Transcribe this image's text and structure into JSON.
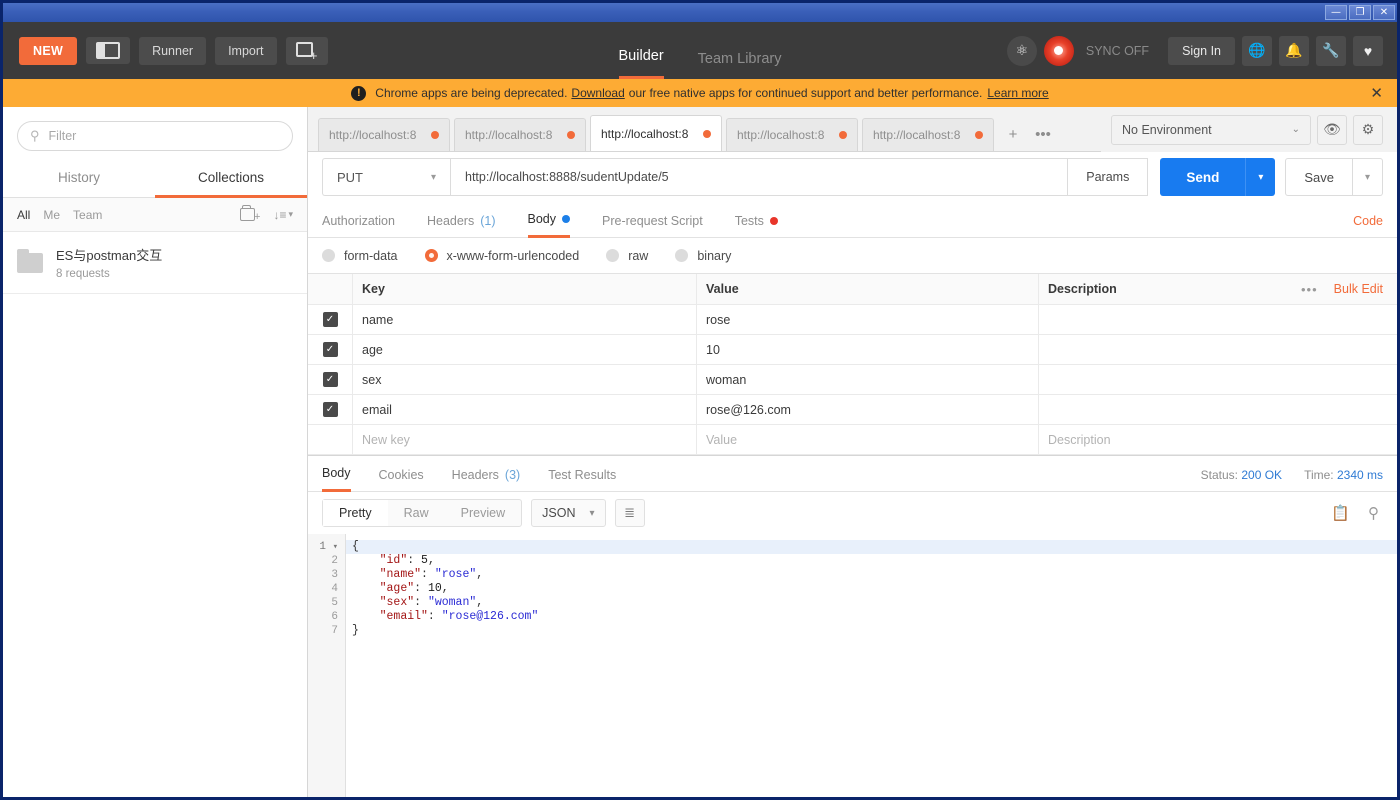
{
  "window": {
    "minimize_label": "—",
    "restore_label": "❐",
    "close_label": "✕"
  },
  "header": {
    "new_button": "NEW",
    "panel_toggle_name": "panel-toggle",
    "runner_button": "Runner",
    "import_button": "Import",
    "new_tab_button": "+",
    "tabs": [
      {
        "label": "Builder",
        "active": true
      },
      {
        "label": "Team Library",
        "active": false
      }
    ],
    "sync_label": "SYNC OFF",
    "signin_button": "Sign In",
    "icons": [
      "globe-icon",
      "bell-icon",
      "wrench-icon",
      "heart-icon"
    ]
  },
  "banner": {
    "text_before": "Chrome apps are being deprecated.",
    "link_download": "Download",
    "text_middle": "our free native apps for continued support and better performance.",
    "link_learn": "Learn more",
    "close_label": "✕",
    "bg_color": "#fdab34"
  },
  "sidebar": {
    "filter_placeholder": "Filter",
    "tabs": [
      {
        "label": "History",
        "active": false
      },
      {
        "label": "Collections",
        "active": true
      }
    ],
    "scopes": [
      {
        "label": "All",
        "active": true
      },
      {
        "label": "Me",
        "active": false
      },
      {
        "label": "Team",
        "active": false
      }
    ],
    "collections": [
      {
        "name": "ES与postman交互",
        "requests": "8 requests"
      }
    ]
  },
  "request_tabs": [
    {
      "label": "http://localhost:8",
      "active": false,
      "unsaved": true
    },
    {
      "label": "http://localhost:8",
      "active": false,
      "unsaved": true
    },
    {
      "label": "http://localhost:8",
      "active": true,
      "unsaved": true
    },
    {
      "label": "http://localhost:8",
      "active": false,
      "unsaved": true
    },
    {
      "label": "http://localhost:8",
      "active": false,
      "unsaved": true
    }
  ],
  "tabbar": {
    "add_tab": "+",
    "more_tabs": "•••"
  },
  "environment": {
    "selected": "No Environment",
    "chevron": "⌄"
  },
  "url_bar": {
    "method": "PUT",
    "url": "http://localhost:8888/sudentUpdate/5",
    "params_button": "Params",
    "send_button": "Send",
    "send_caret": "⌄",
    "save_button": "Save",
    "save_caret": "⌄"
  },
  "request_tabs_row": {
    "items": [
      {
        "label": "Authorization",
        "active": false,
        "badge": "",
        "dot": ""
      },
      {
        "label": "Headers",
        "active": false,
        "badge": "(1)",
        "dot": ""
      },
      {
        "label": "Body",
        "active": true,
        "badge": "",
        "dot": "blue"
      },
      {
        "label": "Pre-request Script",
        "active": false,
        "badge": "",
        "dot": ""
      },
      {
        "label": "Tests",
        "active": false,
        "badge": "",
        "dot": "red"
      }
    ],
    "code_link": "Code"
  },
  "body_types": [
    {
      "label": "form-data",
      "selected": false
    },
    {
      "label": "x-www-form-urlencoded",
      "selected": true
    },
    {
      "label": "raw",
      "selected": false
    },
    {
      "label": "binary",
      "selected": false
    }
  ],
  "kv_table": {
    "headers": {
      "key": "Key",
      "value": "Value",
      "description": "Description"
    },
    "dots": "•••",
    "bulk_edit": "Bulk Edit",
    "rows": [
      {
        "checked": true,
        "key": "name",
        "value": "rose",
        "description": ""
      },
      {
        "checked": true,
        "key": "age",
        "value": "10",
        "description": ""
      },
      {
        "checked": true,
        "key": "sex",
        "value": "woman",
        "description": ""
      },
      {
        "checked": true,
        "key": "email",
        "value": "rose@126.com",
        "description": ""
      }
    ],
    "placeholder_row": {
      "key": "New key",
      "value": "Value",
      "description": "Description"
    }
  },
  "response": {
    "tabs": [
      {
        "label": "Body",
        "active": true,
        "badge": "",
        "dot": ""
      },
      {
        "label": "Cookies",
        "active": false,
        "badge": "",
        "dot": ""
      },
      {
        "label": "Headers",
        "active": false,
        "badge": "(3)",
        "dot": ""
      },
      {
        "label": "Test Results",
        "active": false,
        "badge": "",
        "dot": "red"
      }
    ],
    "status_label": "Status:",
    "status_value": "200 OK",
    "time_label": "Time:",
    "time_value": "2340 ms",
    "view_modes": [
      {
        "label": "Pretty",
        "active": true
      },
      {
        "label": "Raw",
        "active": false
      },
      {
        "label": "Preview",
        "active": false
      }
    ],
    "format": "JSON",
    "format_chevron": "⌄",
    "wrap_icon": "wrap-lines-icon",
    "copy_icon": "copy-icon",
    "search_icon": "search-icon",
    "line_numbers": [
      "1",
      "2",
      "3",
      "4",
      "5",
      "6",
      "7"
    ],
    "code_lines": [
      {
        "n": 1,
        "text": "{",
        "type": "brace"
      },
      {
        "n": 2,
        "key": "\"id\"",
        "sep": ": ",
        "val": "5",
        "tail": ",",
        "type": "num"
      },
      {
        "n": 3,
        "key": "\"name\"",
        "sep": ": ",
        "val": "\"rose\"",
        "tail": ",",
        "type": "str"
      },
      {
        "n": 4,
        "key": "\"age\"",
        "sep": ": ",
        "val": "10",
        "tail": ",",
        "type": "num"
      },
      {
        "n": 5,
        "key": "\"sex\"",
        "sep": ": ",
        "val": "\"woman\"",
        "tail": ",",
        "type": "str"
      },
      {
        "n": 6,
        "key": "\"email\"",
        "sep": ": ",
        "val": "\"rose@126.com\"",
        "tail": "",
        "type": "str"
      },
      {
        "n": 7,
        "text": "}",
        "type": "brace"
      }
    ]
  },
  "colors": {
    "accent_orange": "#f26b3a",
    "send_blue": "#187bf0",
    "banner": "#fdab34",
    "header_dark": "#3b3b3b",
    "status_blue": "#2f7bd4"
  }
}
